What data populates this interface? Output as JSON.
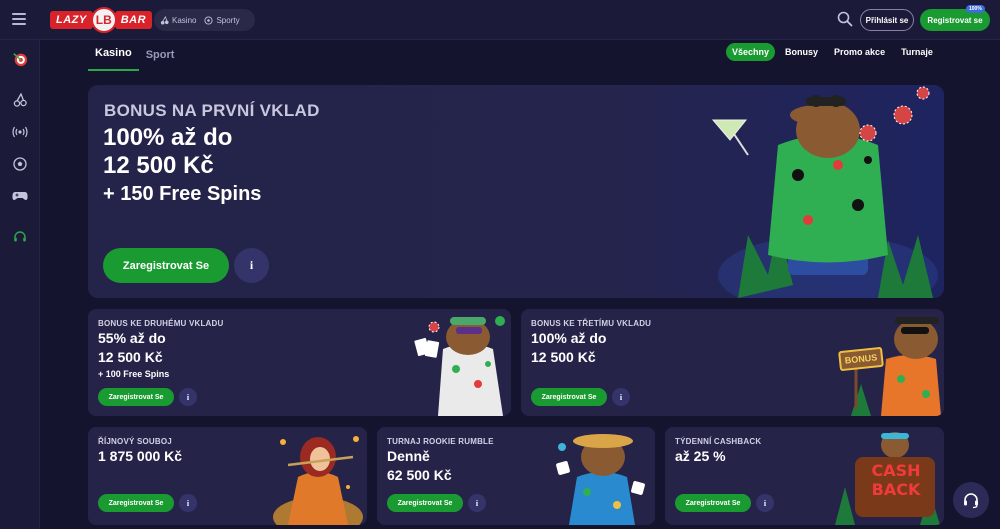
{
  "header": {
    "logo": {
      "left": "LAZY",
      "right": "BAR",
      "badge": "LB"
    },
    "pill": [
      {
        "label": "Kasino",
        "icon": "cherries-icon"
      },
      {
        "label": "Sporty",
        "icon": "ball-icon"
      }
    ],
    "login_label": "Přihlásit se",
    "register_label": "Registrovat se",
    "register_badge": "100%"
  },
  "sidebar": {
    "items": [
      "dartboard-icon",
      "cherries-icon",
      "live-signal-icon",
      "soccer-ball-icon",
      "gamepad-icon",
      "headset-icon"
    ]
  },
  "subnav": {
    "tabs": [
      {
        "label": "Kasino",
        "active": true
      },
      {
        "label": "Sport",
        "active": false
      }
    ],
    "filters": [
      {
        "label": "Všechny",
        "active": true
      },
      {
        "label": "Bonusy"
      },
      {
        "label": "Promo akce"
      },
      {
        "label": "Turnaje"
      }
    ]
  },
  "hero": {
    "subtitle": "BONUS NA PRVNÍ VKLAD",
    "title_line1": "100% až do",
    "title_line2": "12 500 Kč",
    "extra": "+ 150 Free Spins",
    "button": "Zaregistrovat Se",
    "info": "i"
  },
  "cards": [
    {
      "subtitle": "BONUS KE DRUHÉMU VKLADU",
      "line1": "55% až do",
      "line2": "12 500 Kč",
      "extra": "+ 100 Free Spins",
      "button": "Zaregistrovat Se",
      "info": "i"
    },
    {
      "subtitle": "BONUS KE TŘETÍMU VKLADU",
      "line1": "100% až do",
      "line2": "12 500 Kč",
      "extra": "",
      "button": "Zaregistrovat Se",
      "info": "i",
      "sign": "BONUS"
    },
    {
      "subtitle": "ŘÍJNOVÝ SOUBOJ",
      "line1": "1 875 000 Kč",
      "line2": "",
      "extra": "",
      "button": "Zaregistrovat Se",
      "info": "i"
    },
    {
      "subtitle": "TURNAJ ROOKIE RUMBLE",
      "line1": "Denně",
      "line2": "62 500 Kč",
      "extra": "",
      "button": "Zaregistrovat Se",
      "info": "i"
    },
    {
      "subtitle": "TÝDENNÍ CASHBACK",
      "line1": "až 25 %",
      "line2": "",
      "extra": "",
      "button": "Zaregistrovat Se",
      "info": "i",
      "art_line1": "CASH",
      "art_line2": "BACK"
    }
  ],
  "colors": {
    "accent": "#1a9b32",
    "background": "#15142e",
    "card": "#252448",
    "brand_red": "#d9232a"
  }
}
